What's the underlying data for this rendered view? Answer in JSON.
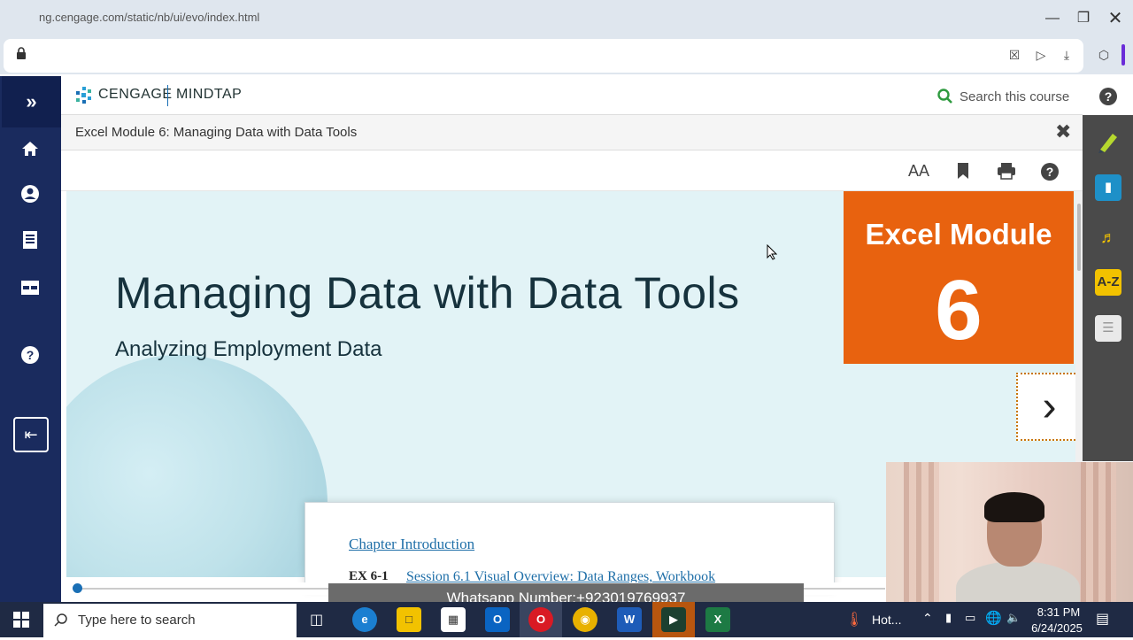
{
  "browser": {
    "url": "ng.cengage.com/static/nb/ui/evo/index.html"
  },
  "header": {
    "brand": "CENGAGE",
    "product": "MINDTAP",
    "search_placeholder": "Search this course"
  },
  "breadcrumb": "Excel Module 6: Managing Data with Data Tools",
  "toolbar": {
    "font_size_label": "AA"
  },
  "slide": {
    "title": "Managing Data with Data Tools",
    "subtitle": "Analyzing Employment Data",
    "module_label": "Excel Module",
    "module_number": "6",
    "toc_link": "Chapter Introduction",
    "toc_line_num": "EX 6-1",
    "toc_line_text": "Session 6.1 Visual Overview: Data Ranges, Workbook"
  },
  "right_tools": {
    "az_label": "A-Z"
  },
  "overlay": {
    "whatsapp": "Whatsapp Number:+923019769937"
  },
  "taskbar": {
    "search_placeholder": "Type here to search",
    "weather": "Hot...",
    "time": "8:31 PM",
    "date": "6/24/2025"
  },
  "colors": {
    "nav_bg": "#1a2b5e",
    "module_orange": "#e8620f",
    "slide_bg": "#e2f3f6",
    "link_blue": "#1f6fa8"
  }
}
